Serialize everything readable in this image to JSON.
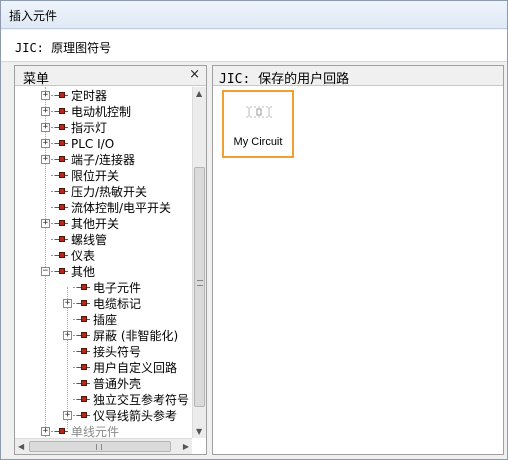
{
  "window": {
    "title": "插入元件"
  },
  "header": {
    "title": "JIC: 原理图符号"
  },
  "left_panel": {
    "title": "菜单",
    "close_glyph": "×",
    "tree": [
      {
        "label": "定时器",
        "expander": "+"
      },
      {
        "label": "电动机控制",
        "expander": "+"
      },
      {
        "label": "指示灯",
        "expander": "+"
      },
      {
        "label": "PLC I/O",
        "expander": "+"
      },
      {
        "label": "端子/连接器",
        "expander": "+"
      },
      {
        "label": "限位开关",
        "expander": ""
      },
      {
        "label": "压力/热敏开关",
        "expander": ""
      },
      {
        "label": "流体控制/电平开关",
        "expander": ""
      },
      {
        "label": "其他开关",
        "expander": "+"
      },
      {
        "label": "螺线管",
        "expander": ""
      },
      {
        "label": "仪表",
        "expander": ""
      },
      {
        "label": "其他",
        "expander": "−"
      },
      {
        "label": "电子元件",
        "expander": ""
      },
      {
        "label": "电缆标记",
        "expander": "+"
      },
      {
        "label": "插座",
        "expander": ""
      },
      {
        "label": "屏蔽 (非智能化)",
        "expander": "+"
      },
      {
        "label": "接头符号",
        "expander": ""
      },
      {
        "label": "用户自定义回路",
        "expander": ""
      },
      {
        "label": "普通外壳",
        "expander": ""
      },
      {
        "label": "独立交互参考符号",
        "expander": ""
      },
      {
        "label": "仪导线箭头参考",
        "expander": "+"
      },
      {
        "label": "单线元件",
        "expander": "+"
      }
    ]
  },
  "right_panel": {
    "title": "JIC: 保存的用户回路",
    "items": [
      {
        "caption": "My Circuit"
      }
    ]
  },
  "icons": {
    "tree_symbol": "component-symbol-icon",
    "scroll_up": "▲",
    "scroll_down": "▼",
    "scroll_left": "◀",
    "scroll_right": "▶"
  },
  "colors": {
    "tile_border": "#f0a030",
    "component_red": "#b22a1c"
  }
}
